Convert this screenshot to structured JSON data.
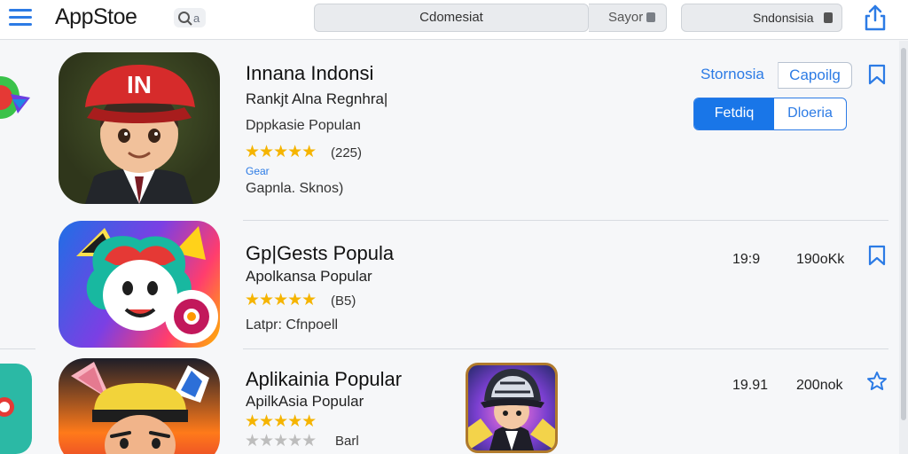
{
  "header": {
    "logo": "AppStoe",
    "search_glyph_tail": "a",
    "search_value": "Cdomesiat",
    "region_label": "Sayor",
    "language_label": "Sndonsisia"
  },
  "colors": {
    "accent": "#2c7be5",
    "star": "#f5b400",
    "segment_active": "#1976e8"
  },
  "apps": [
    {
      "title": "Innana Indonsi",
      "subtitle": "Rankjt Alna Regnhra|",
      "category": "Dppkasie Populan",
      "stars": 5,
      "rating_count": "(225)",
      "tag": "Gear",
      "footer": "Gapnla. Sknos)",
      "icon": "cartoon-boy-red-cap-icon",
      "icon_text": "IN",
      "link_label": "Stornosia",
      "outline_button": "Capoilg",
      "segment_active": "Fetdiq",
      "segment_inactive": "Dloeria"
    },
    {
      "title": "Gp|Gests Popula",
      "subtitle": "Apolkansa Popular",
      "stars": 5,
      "rating_count": "(B5)",
      "footer": "Latpr: Cfnpoell",
      "icon": "colorful-mascot-icon",
      "version": "19:9",
      "size": "190oKk"
    },
    {
      "title": "Aplikainia Popular",
      "subtitle": "ApilkAsia Popular",
      "stars": 5,
      "secondary_stars": 5,
      "rating_label": "Barl",
      "icon": "cartoon-warrior-icon",
      "thumbnail_icon": "hat-character-thumbnail-icon",
      "version": "19.91",
      "size": "200nok"
    }
  ]
}
